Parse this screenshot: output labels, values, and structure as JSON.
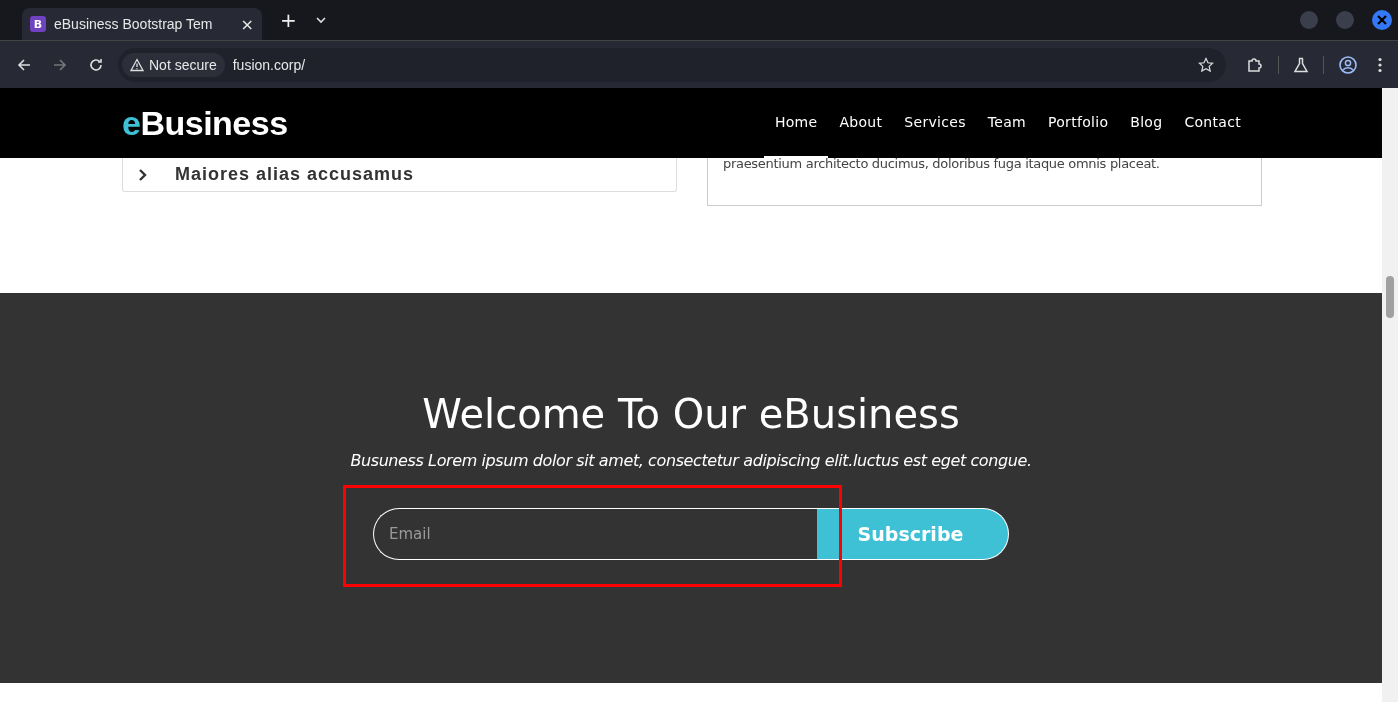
{
  "browser": {
    "tab": {
      "favicon": "B",
      "title": "eBusiness Bootstrap Tem",
      "close": "×"
    },
    "new_tab": "+",
    "security": "Not secure",
    "url": "fusion.corp/"
  },
  "header": {
    "logo_accent": "e",
    "logo_rest": "Business",
    "nav": [
      {
        "label": "Home",
        "selected": true
      },
      {
        "label": "About",
        "selected": false
      },
      {
        "label": "Services",
        "selected": false
      },
      {
        "label": "Team",
        "selected": false
      },
      {
        "label": "Portfolio",
        "selected": false
      },
      {
        "label": "Blog",
        "selected": false
      },
      {
        "label": "Contact",
        "selected": false
      }
    ]
  },
  "accordion": {
    "title": "Maiores alias accusamus"
  },
  "panel": {
    "text": "praesentium architecto ducimus, doloribus fuga itaque omnis placeat."
  },
  "subscribe": {
    "title": "Welcome To Our eBusiness",
    "subtitle": "Busuness Lorem ipsum dolor sit amet, consectetur adipiscing elit.luctus est eget congue.",
    "placeholder": "Email",
    "button": "Subscribe",
    "highlighted": true
  }
}
